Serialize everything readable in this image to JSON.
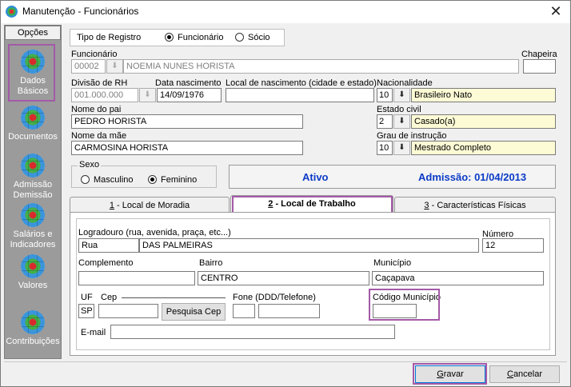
{
  "window": {
    "title": "Manutenção - Funcionários",
    "close_glyph": "✕"
  },
  "sidebar": {
    "header": "Opções",
    "items": [
      {
        "label": "Dados Básicos",
        "icon": "globe-icon"
      },
      {
        "label": "Documentos",
        "icon": "globe-icon"
      },
      {
        "label": "Admissão Demissão",
        "icon": "globe-icon"
      },
      {
        "label": "Salários e Indicadores",
        "icon": "globe-icon"
      },
      {
        "label": "Valores",
        "icon": "globe-icon"
      },
      {
        "label": "Contribuições",
        "icon": "globe-icon"
      }
    ]
  },
  "registro": {
    "label": "Tipo de Registro",
    "opt1": "Funcionário",
    "opt2": "Sócio",
    "selected": "Funcionário"
  },
  "funcionario": {
    "label": "Funcionário",
    "code": "00002",
    "name": "NOEMIA NUNES HORISTA"
  },
  "chapeira": {
    "label": "Chapeira",
    "value": ""
  },
  "divisao": {
    "label": "Divisão de RH",
    "value": "001.000.000"
  },
  "nascimento": {
    "label": "Data nascimento",
    "value": "14/09/1976"
  },
  "local_nasc": {
    "label": "Local de nascimento (cidade e estado)",
    "value": ""
  },
  "nacionalidade": {
    "label": "Nacionalidade",
    "code": "10",
    "value": "Brasileiro Nato"
  },
  "pai": {
    "label": "Nome do pai",
    "value": "PEDRO HORISTA"
  },
  "estado_civil": {
    "label": "Estado civil",
    "code": "2",
    "value": "Casado(a)"
  },
  "mae": {
    "label": "Nome da mãe",
    "value": "CARMOSINA HORISTA"
  },
  "instrucao": {
    "label": "Grau de instrução",
    "code": "10",
    "value": "Mestrado Completo"
  },
  "sexo": {
    "label": "Sexo",
    "opt1": "Masculino",
    "opt2": "Feminino",
    "selected": "Feminino"
  },
  "status": {
    "ativo": "Ativo",
    "admissao": "Admissão: 01/04/2013"
  },
  "tabs": [
    {
      "num": "1",
      "label": " - Local de Moradia"
    },
    {
      "num": "2",
      "label": " - Local de Trabalho"
    },
    {
      "num": "3",
      "label": " - Características Físicas"
    }
  ],
  "trabalho": {
    "logradouro_label": "Logradouro (rua, avenida, praça, etc...)",
    "tipo": "Rua",
    "logradouro": "DAS PALMEIRAS",
    "numero_label": "Número",
    "numero": "12",
    "complemento_label": "Complemento",
    "complemento": "",
    "bairro_label": "Bairro",
    "bairro": "CENTRO",
    "municipio_label": "Município",
    "municipio": "Caçapava",
    "uf_label": "UF",
    "uf": "SP",
    "cep_label": "Cep",
    "cep": "",
    "pesquisa_cep": "Pesquisa Cep",
    "fone_label": "Fone (DDD/Telefone)",
    "ddd": "",
    "telefone": "",
    "cod_municipio_label": "Código Município",
    "cod_municipio": "",
    "email_label": "E-mail",
    "email": ""
  },
  "buttons": {
    "gravar_first": "G",
    "gravar_rest": "ravar",
    "cancelar_first": "C",
    "cancelar_rest": "ancelar"
  },
  "colors": {
    "highlight": "#a45aa8",
    "status_blue": "#0b3bc7",
    "readonly_yellow": "#fdfbd5",
    "sidebar_gray": "#9b9b9b"
  }
}
